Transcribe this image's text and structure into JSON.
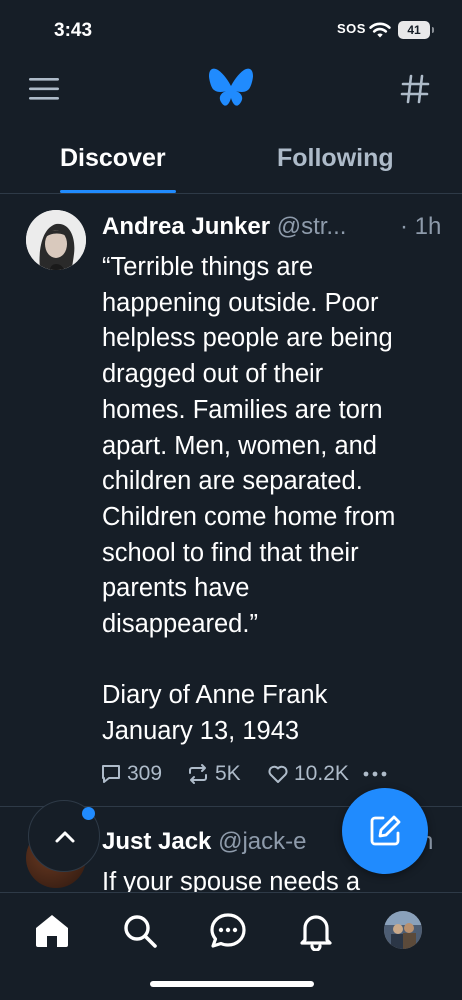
{
  "status_bar": {
    "time": "3:43",
    "sos": "SOS",
    "battery": "41"
  },
  "header": {
    "menu_icon": "hamburger-menu-icon",
    "logo_icon": "butterfly-logo-icon",
    "feeds_icon": "hashtag-icon",
    "accent_color": "#208bfe"
  },
  "tabs": [
    {
      "label": "Discover",
      "active": true
    },
    {
      "label": "Following",
      "active": false
    }
  ],
  "post": {
    "author_name": "Andrea Junker",
    "author_handle": "@str...",
    "time": "· 1h",
    "body_lines": [
      "“Terrible things are",
      "happening outside. Poor",
      "helpless people are being",
      "dragged out of their",
      "homes. Families are torn",
      "apart. Men, women, and",
      "children are separated.",
      "Children come home from",
      "school to find that their",
      "parents have",
      "disappeared.”"
    ],
    "source_lines": [
      "Diary of Anne Frank",
      "January 13, 1943"
    ],
    "replies": "309",
    "reposts": "5K",
    "likes": "10.2K"
  },
  "post2": {
    "author_name": "Just Jack",
    "author_handle": "@jack-e",
    "time": "h",
    "body": "If your spouse needs a"
  },
  "nav": {
    "items": [
      "home-icon",
      "search-icon",
      "chat-icon",
      "bell-icon",
      "profile-avatar"
    ]
  }
}
